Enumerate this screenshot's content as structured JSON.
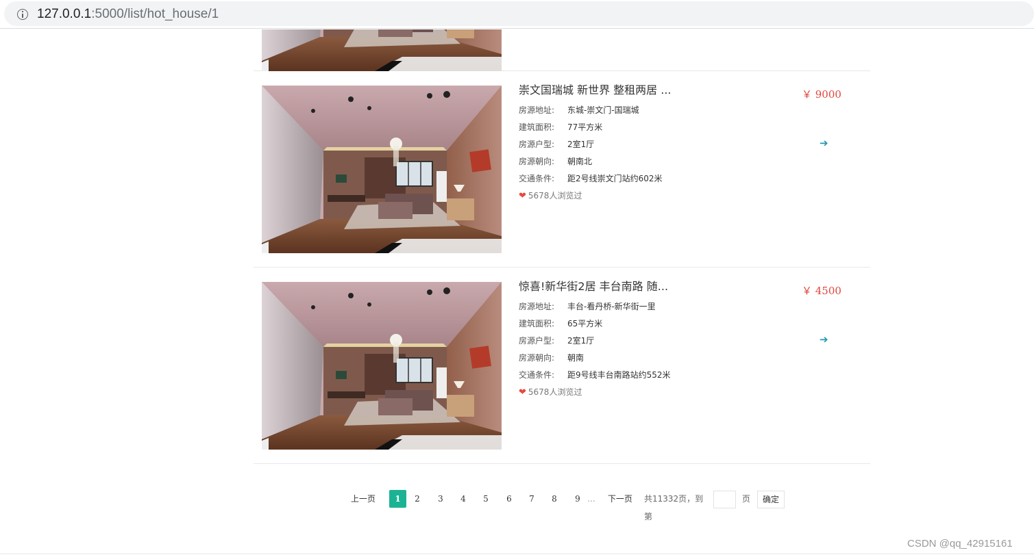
{
  "browser": {
    "url_host": "127.0.0.1",
    "url_rest": ":5000/list/hot_house/1"
  },
  "labels": {
    "address": "房源地址:",
    "area": "建筑面积:",
    "layout": "房源户型:",
    "orientation": "房源朝向:",
    "traffic": "交通条件:"
  },
  "houses": [
    {
      "title": "崇文国瑞城 新世界 整租两居 ...",
      "price": "￥ 9000",
      "address": "东城-崇文门-国瑞城",
      "area": "77平方米",
      "layout": "2室1厅",
      "orientation": "朝南北",
      "traffic": "距2号线崇文门站约602米",
      "views": "5678人浏览过"
    },
    {
      "title": "惊喜!新华街2居 丰台南路 随...",
      "price": "￥ 4500",
      "address": "丰台-看丹桥-新华街一里",
      "area": "65平方米",
      "layout": "2室1厅",
      "orientation": "朝南",
      "traffic": "距9号线丰台南路站约552米",
      "views": "5678人浏览过"
    }
  ],
  "pagination": {
    "prev": "上一页",
    "pages": [
      "1",
      "2",
      "3",
      "4",
      "5",
      "6",
      "7",
      "8",
      "9"
    ],
    "current": "1",
    "ellipsis": "...",
    "next": "下一页",
    "total": "共11332页，到第",
    "page_unit": "页",
    "confirm": "确定"
  },
  "watermark": "CSDN @qq_42915161",
  "colors": {
    "price": "#e0463e",
    "arrow": "#1f97b3",
    "current_page": "#1cb394",
    "heart": "#e8493f"
  },
  "icons": {
    "info": "info-circle-icon",
    "heart": "heart-icon",
    "arrow": "arrow-right-icon"
  }
}
